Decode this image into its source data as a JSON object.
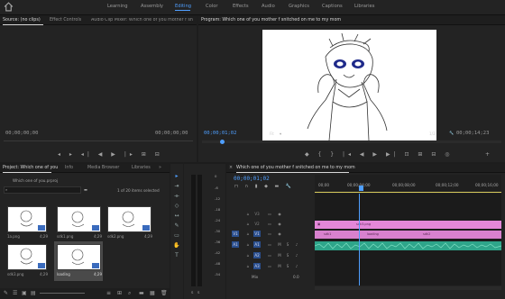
{
  "workspaces": {
    "items": [
      "Learning",
      "Assembly",
      "Editing",
      "Color",
      "Effects",
      "Audio",
      "Graphics",
      "Captions",
      "Libraries"
    ],
    "active": "Editing"
  },
  "source_panel": {
    "tabs": [
      "Source: (no clips)",
      "Effect Controls",
      "Audio Clip Mixer: Which one of you mother f sn"
    ],
    "timecode_left": "00;00;00;00",
    "timecode_right": "00;00;00;00"
  },
  "program_panel": {
    "title": "Program: Which one of you mother f snitched on me to my mom",
    "timecode": "00;00;01;02",
    "fit": "Fit",
    "ratio": "1/2",
    "duration": "00;00;14;23"
  },
  "project_panel": {
    "tabs": [
      "Project: Which one of you",
      "Info",
      "Media Browser",
      "Libraries"
    ],
    "project_file": "Which one of you.prproj",
    "item_count": "1 of 20 items selected",
    "thumbnails": [
      {
        "name": "1a.png",
        "duration": "4;29"
      },
      {
        "name": "sdk1.png",
        "duration": "4;29"
      },
      {
        "name": "sdk2.png",
        "duration": "4;29"
      },
      {
        "name": "sdk3.png",
        "duration": "4;29"
      },
      {
        "name": "loading",
        "duration": "4;29"
      }
    ]
  },
  "timeline": {
    "tab": "Which one of you mother f snitched on me to my mom",
    "timecode": "00;00;01;02",
    "ruler": [
      "00;00",
      "00;00;04;00",
      "00;00;08;00",
      "00;00;12;00",
      "00;00;16;00"
    ],
    "tracks": [
      "V3",
      "V2",
      "V1",
      "A1",
      "A2",
      "A3"
    ],
    "source_patch": [
      "V1",
      "A1"
    ],
    "mix_label": "Mix",
    "mix_value": "0.0",
    "clips": {
      "v2_label": "sdk3.png",
      "v1_labels": [
        "sdk1",
        "loading",
        "sdk2"
      ]
    }
  },
  "audio_meter": {
    "scale": [
      "0",
      "-6",
      "-12",
      "-18",
      "-24",
      "-30",
      "-36",
      "-42",
      "-48",
      "-54"
    ],
    "bottom": [
      "S",
      "S"
    ]
  },
  "colors": {
    "accent": "#4f9fff",
    "panel": "#232323",
    "clip_video": "#e387d8",
    "clip_audio": "#2ea58a"
  }
}
